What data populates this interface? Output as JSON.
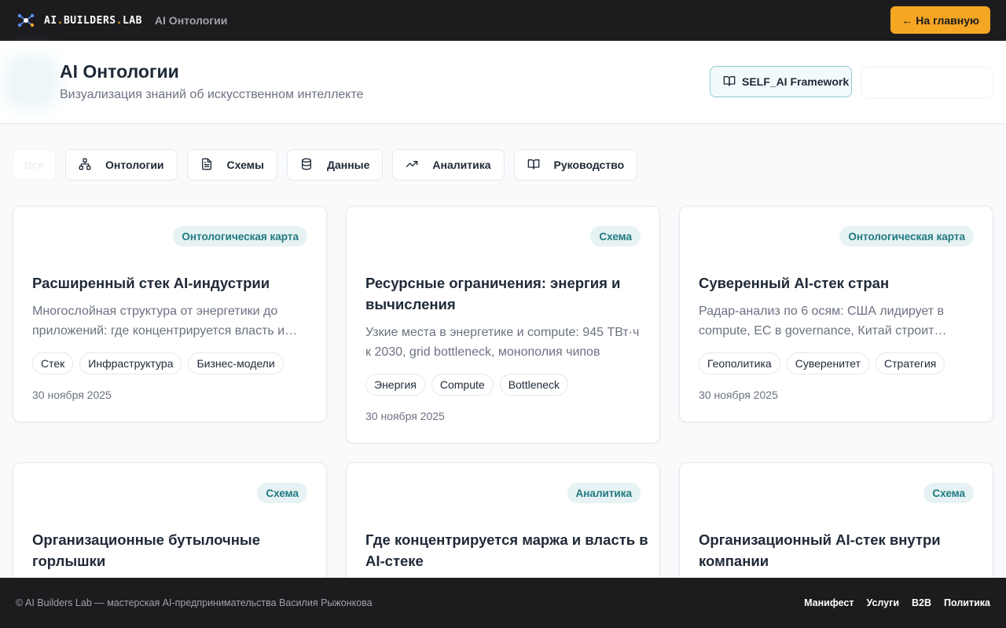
{
  "topbar": {
    "logo_part1": "AI",
    "logo_dot1": ".",
    "logo_part2": "BUILDERS",
    "logo_dot2": ".",
    "logo_part3": "LAB",
    "breadcrumb": "AI Онтологии",
    "home_button": "← На главную"
  },
  "header": {
    "title": "AI Онтологии",
    "subtitle": "Визуализация знаний об искусственном интеллекте",
    "framework_button": "SELF_AI Framework"
  },
  "filters": [
    {
      "label": "Все",
      "icon": "none"
    },
    {
      "label": "Онтологии",
      "icon": "hierarchy-icon"
    },
    {
      "label": "Схемы",
      "icon": "document-icon"
    },
    {
      "label": "Данные",
      "icon": "database-icon"
    },
    {
      "label": "Аналитика",
      "icon": "trending-up-icon"
    },
    {
      "label": "Руководство",
      "icon": "book-icon"
    }
  ],
  "cards": [
    {
      "badge": "Онтологическая карта",
      "title": "Расширенный стек AI-индустрии",
      "description": "Многослойная структура от энергетики до приложений: где концентрируется власть и…",
      "tags": [
        "Стек",
        "Инфраструктура",
        "Бизнес-модели"
      ],
      "date": "30 ноября 2025"
    },
    {
      "badge": "Схема",
      "title": "Ресурсные ограничения: энергия и вычисления",
      "description": "Узкие места в энергетике и compute: 945 ТВт·ч к 2030, grid bottleneck, монополия чипов",
      "tags": [
        "Энергия",
        "Compute",
        "Bottleneck"
      ],
      "date": "30 ноября 2025"
    },
    {
      "badge": "Онтологическая карта",
      "title": "Суверенный AI-стек стран",
      "description": "Радар-анализ по 6 осям: США лидирует в compute, ЕС в governance, Китай строит…",
      "tags": [
        "Геополитика",
        "Суверенитет",
        "Стратегия"
      ],
      "date": "30 ноября 2025"
    },
    {
      "badge": "Схема",
      "title": "Организационные бутылочные горлышки"
    },
    {
      "badge": "Аналитика",
      "title": "Где концентрируется маржа и власть в AI-стеке"
    },
    {
      "badge": "Схема",
      "title": "Организационный AI-стек внутри компании"
    }
  ],
  "footer": {
    "copyright": "© AI Builders Lab — мастерская AI-предпринимательства Василия Рыжонкова",
    "links": [
      "Манифест",
      "Услуги",
      "B2B",
      "Политика"
    ]
  },
  "colors": {
    "accent": "#f5a623",
    "topbar_bg": "#1c1c1f",
    "badge_bg": "#e6f2f3",
    "badge_text": "#217a80"
  }
}
